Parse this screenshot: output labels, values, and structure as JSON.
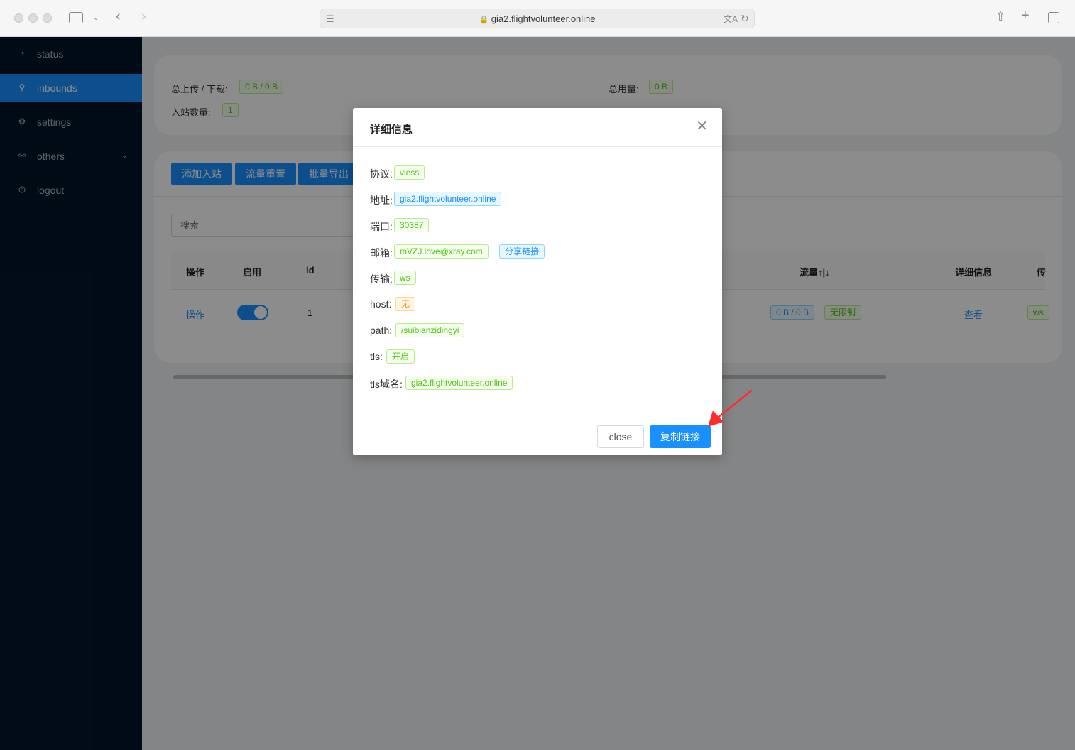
{
  "browser": {
    "url": "gia2.flightvolunteer.online"
  },
  "sidebar": {
    "items": [
      {
        "label": "status"
      },
      {
        "label": "inbounds"
      },
      {
        "label": "settings"
      },
      {
        "label": "others"
      },
      {
        "label": "logout"
      }
    ]
  },
  "stats": {
    "upload_download_label": "总上传 / 下载:",
    "upload_download_value": "0 B / 0 B",
    "total_usage_label": "总用量:",
    "total_usage_value": "0 B",
    "inbound_count_label": "入站数量:",
    "inbound_count_value": "1"
  },
  "toolbar": {
    "add_label": "添加入站",
    "reset_label": "流量重置",
    "export_label": "批量导出"
  },
  "search": {
    "placeholder": "搜索"
  },
  "table": {
    "headers": {
      "action": "操作",
      "enable": "启用",
      "id": "id",
      "traffic": "流量↑|↓",
      "detail": "详细信息",
      "transport": "传"
    },
    "row": {
      "action": "操作",
      "id": "1",
      "traffic": "0 B / 0 B",
      "limit": "无限制",
      "detail": "查看",
      "transport": "ws"
    }
  },
  "modal": {
    "title": "详细信息",
    "fields": {
      "protocol_label": "协议:",
      "protocol_value": "vless",
      "address_label": "地址:",
      "address_value": "gia2.flightvolunteer.online",
      "port_label": "端口:",
      "port_value": "30387",
      "email_label": "邮箱:",
      "email_value": "mVZJ.love@xray.com",
      "share_link": "分享链接",
      "transport_label": "传输:",
      "transport_value": "ws",
      "host_label": "host:",
      "host_value": "无",
      "path_label": "path:",
      "path_value": "/suibianzidingyi",
      "tls_label": "tls:",
      "tls_value": "开启",
      "tls_domain_label": "tls域名:",
      "tls_domain_value": "gia2.flightvolunteer.online"
    },
    "close_label": "close",
    "copy_label": "复制链接"
  },
  "colors": {
    "sidebar_bg": "#011528",
    "primary": "#1890ff",
    "tag_green": "#52c41a",
    "arrow": "#ff2b2b"
  }
}
